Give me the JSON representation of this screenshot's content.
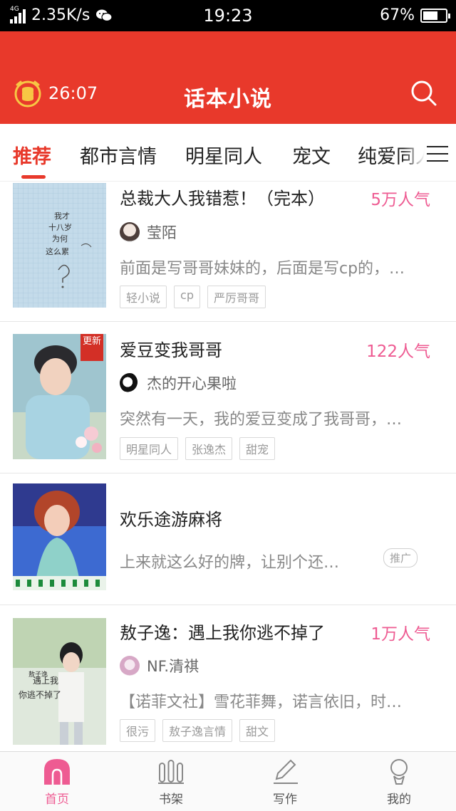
{
  "status_bar": {
    "network_type": "4G",
    "speed": "2.35K/s",
    "time": "19:23",
    "battery": "67%",
    "battery_level": 0.67
  },
  "header": {
    "timer": "26:07",
    "title": "话本小说"
  },
  "tabs": [
    {
      "label": "推荐",
      "active": true
    },
    {
      "label": "都市言情",
      "active": false
    },
    {
      "label": "明星同人",
      "active": false
    },
    {
      "label": "宠文",
      "active": false
    },
    {
      "label": "纯爱同人",
      "active": false
    }
  ],
  "books": [
    {
      "title": "总裁大人我错惹！（完本）",
      "popularity": "5万人气",
      "author": "莹陌",
      "description": "前面是写哥哥妹妹的，后面是写cp的，…",
      "tags": [
        "轻小说",
        "cp",
        "严厉哥哥"
      ]
    },
    {
      "title": "爱豆变我哥哥",
      "popularity": "122人气",
      "author": "杰的开心果啦",
      "description": "突然有一天，我的爱豆变成了我哥哥，…",
      "tags": [
        "明星同人",
        "张逸杰",
        "甜宠"
      ],
      "badge": "更新"
    },
    {
      "title": "欢乐途游麻将",
      "description": "上来就这么好的牌，让别个还…",
      "promo_label": "推广"
    },
    {
      "title": "敖子逸：遇上我你逃不掉了",
      "popularity": "1万人气",
      "author": "NF.清祺",
      "description": "【诺菲文社】雪花菲舞，诺言依旧，时…",
      "tags": [
        "很污",
        "敖子逸言情",
        "甜文"
      ]
    }
  ],
  "bottom_nav": [
    {
      "label": "首页",
      "icon": "home-icon",
      "active": true
    },
    {
      "label": "书架",
      "icon": "bookshelf-icon",
      "active": false
    },
    {
      "label": "写作",
      "icon": "pen-icon",
      "active": false
    },
    {
      "label": "我的",
      "icon": "profile-icon",
      "active": false
    }
  ],
  "colors": {
    "brand_red": "#e8392b",
    "popularity_pink": "#ee5b92",
    "nav_active": "#ee5b92"
  }
}
